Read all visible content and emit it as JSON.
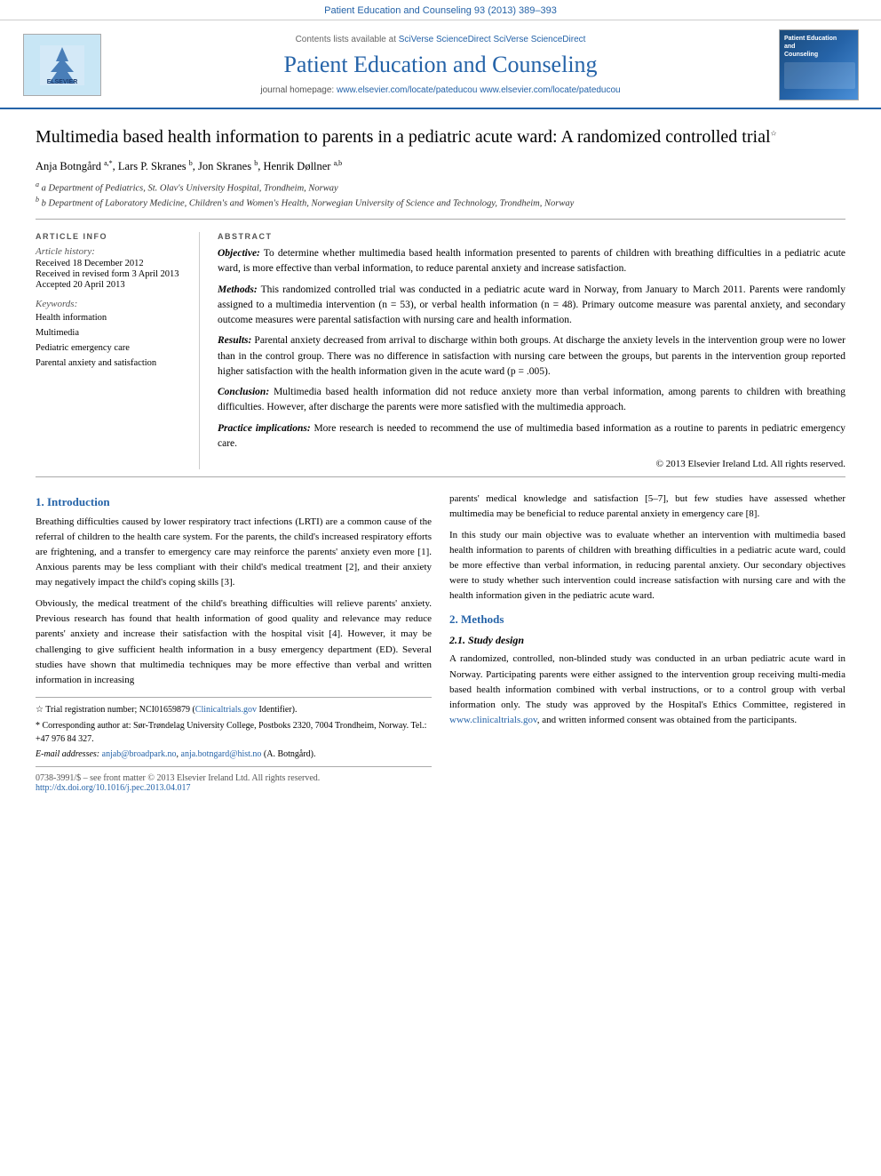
{
  "topbar": {
    "text": "Patient Education and Counseling 93 (2013) 389–393"
  },
  "header": {
    "sciverse_text": "Contents lists available at",
    "sciverse_link": "SciVerse ScienceDirect",
    "journal_title": "Patient Education and Counseling",
    "homepage_label": "journal homepage:",
    "homepage_url": "www.elsevier.com/locate/pateducou",
    "elsevier_label": "ELSEVIER"
  },
  "article": {
    "title": "Multimedia based health information to parents in a pediatric acute ward: A randomized controlled trial",
    "title_note": "☆",
    "authors": "Anja Botngård a,*, Lars P. Skranes b, Jon Skranes b, Henrik Døllner a,b",
    "affiliations": [
      "a Department of Pediatrics, St. Olav's University Hospital, Trondheim, Norway",
      "b Department of Laboratory Medicine, Children's and Women's Health, Norwegian University of Science and Technology, Trondheim, Norway"
    ]
  },
  "article_info": {
    "section_label": "ARTICLE INFO",
    "history_label": "Article history:",
    "received": "Received 18 December 2012",
    "revised": "Received in revised form 3 April 2013",
    "accepted": "Accepted 20 April 2013",
    "keywords_label": "Keywords:",
    "keywords": [
      "Health information",
      "Multimedia",
      "Pediatric emergency care",
      "Parental anxiety and satisfaction"
    ]
  },
  "abstract": {
    "section_label": "ABSTRACT",
    "objective_label": "Objective:",
    "objective_text": " To determine whether multimedia based health information presented to parents of children with breathing difficulties in a pediatric acute ward, is more effective than verbal information, to reduce parental anxiety and increase satisfaction.",
    "methods_label": "Methods:",
    "methods_text": " This randomized controlled trial was conducted in a pediatric acute ward in Norway, from January to March 2011. Parents were randomly assigned to a multimedia intervention (n = 53), or verbal health information (n = 48). Primary outcome measure was parental anxiety, and secondary outcome measures were parental satisfaction with nursing care and health information.",
    "results_label": "Results:",
    "results_text": " Parental anxiety decreased from arrival to discharge within both groups. At discharge the anxiety levels in the intervention group were no lower than in the control group. There was no difference in satisfaction with nursing care between the groups, but parents in the intervention group reported higher satisfaction with the health information given in the acute ward (p = .005).",
    "conclusion_label": "Conclusion:",
    "conclusion_text": " Multimedia based health information did not reduce anxiety more than verbal information, among parents to children with breathing difficulties. However, after discharge the parents were more satisfied with the multimedia approach.",
    "practice_label": "Practice implications:",
    "practice_text": " More research is needed to recommend the use of multimedia based information as a routine to parents in pediatric emergency care.",
    "copyright": "© 2013 Elsevier Ireland Ltd. All rights reserved."
  },
  "introduction": {
    "section_number": "1.",
    "section_title": "Introduction",
    "paragraph1": "Breathing difficulties caused by lower respiratory tract infections (LRTI) are a common cause of the referral of children to the health care system. For the parents, the child's increased respiratory efforts are frightening, and a transfer to emergency care may reinforce the parents' anxiety even more [1]. Anxious parents may be less compliant with their child's medical treatment [2], and their anxiety may negatively impact the child's coping skills [3].",
    "paragraph2": "Obviously, the medical treatment of the child's breathing difficulties will relieve parents' anxiety. Previous research has found that health information of good quality and relevance may reduce parents' anxiety and increase their satisfaction with the hospital visit [4]. However, it may be challenging to give sufficient health information in a busy emergency department (ED). Several studies have shown that multimedia techniques may be more effective than verbal and written information in increasing",
    "paragraph3": "parents' medical knowledge and satisfaction [5–7], but few studies have assessed whether multimedia may be beneficial to reduce parental anxiety in emergency care [8].",
    "paragraph4": "In this study our main objective was to evaluate whether an intervention with multimedia based health information to parents of children with breathing difficulties in a pediatric acute ward, could be more effective than verbal information, in reducing parental anxiety. Our secondary objectives were to study whether such intervention could increase satisfaction with nursing care and with the health information given in the pediatric acute ward."
  },
  "methods": {
    "section_number": "2.",
    "section_title": "Methods",
    "subsection_number": "2.1.",
    "subsection_title": "Study design",
    "paragraph1": "A randomized, controlled, non-blinded study was conducted in an urban pediatric acute ward in Norway. Participating parents were either assigned to the intervention group receiving multi-media based health information combined with verbal instructions, or to a control group with verbal information only. The study was approved by the Hospital's Ethics Committee, registered in www.clinicaltrials.gov, and written informed consent was obtained from the participants."
  },
  "footnotes": {
    "trial_note": "☆ Trial registration number; NCI01659879 (Clinicaltrials.gov Identifier).",
    "corresponding_note": "* Corresponding author at: Sør-Trøndelag University College, Postboks 2320, 7004 Trondheim, Norway. Tel.: +47 976 84 327.",
    "email_label": "E-mail addresses:",
    "email1": "anjab@broadpark.no",
    "email2": "anja.botngard@hist.no",
    "email_suffix": "(A. Botngård)."
  },
  "doi": {
    "issn": "0738-3991/$ – see front matter © 2013 Elsevier Ireland Ltd. All rights reserved.",
    "doi_label": "http://dx.doi.org/10.1016/j.pec.2013.04.017"
  }
}
